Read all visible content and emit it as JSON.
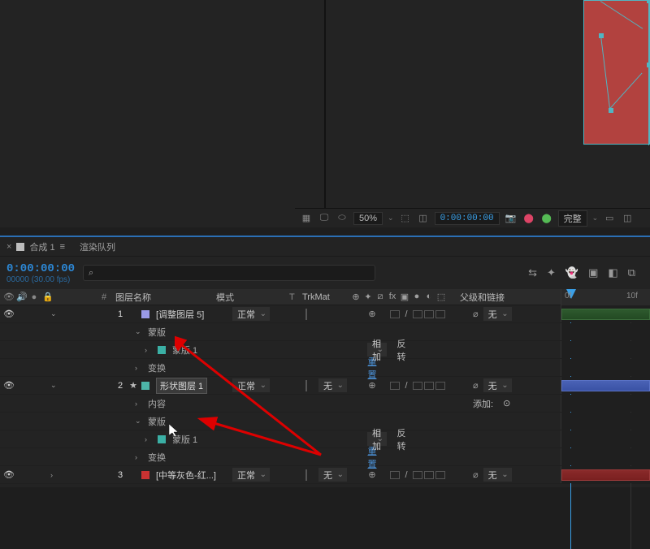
{
  "preview": {
    "zoom": "50%",
    "timecode": "0:00:00:00",
    "res": "完整"
  },
  "tabs": {
    "comp": "合成 1",
    "menu_glyph": "≡",
    "render_queue": "渲染队列"
  },
  "head": {
    "timecode": "0:00:00:00",
    "fps": "00000 (30.00 fps)",
    "search_placeholder": "⌕"
  },
  "cols": {
    "num": "#",
    "name": "图层名称",
    "mode": "模式",
    "t": "T",
    "trkmat": "TrkMat",
    "parent": "父级和链接"
  },
  "ruler": {
    "t0": "0f",
    "t1": "10f"
  },
  "layers": [
    {
      "num": "1",
      "name": "[调整图层 5]",
      "mode": "正常",
      "trkmat": "",
      "parent": "无",
      "color": "c-lav",
      "bar": "bar-green",
      "expanded": true,
      "children": [
        {
          "type": "group",
          "label": "蒙版",
          "expanded": true
        },
        {
          "type": "mask",
          "label": "蒙版 1",
          "mode": "相加",
          "invert": "反转",
          "color": "c-cyan"
        },
        {
          "type": "group",
          "label": "变换",
          "reset": "重置"
        }
      ]
    },
    {
      "num": "2",
      "name": "形状图层 1",
      "mode": "正常",
      "trkmat": "无",
      "parent": "无",
      "color": "c-teal",
      "bar": "bar-blue",
      "expanded": true,
      "starred": true,
      "boxed": true,
      "children": [
        {
          "type": "group",
          "label": "内容",
          "add": "添加:"
        },
        {
          "type": "group",
          "label": "蒙版",
          "expanded": true
        },
        {
          "type": "mask",
          "label": "蒙版 1",
          "mode": "相加",
          "invert": "反转",
          "color": "c-cyan"
        },
        {
          "type": "group",
          "label": "变换",
          "reset": "重置"
        }
      ]
    },
    {
      "num": "3",
      "name": "[中等灰色-红...]",
      "mode": "正常",
      "trkmat": "无",
      "parent": "无",
      "color": "c-red",
      "bar": "bar-red",
      "expanded": false
    }
  ]
}
